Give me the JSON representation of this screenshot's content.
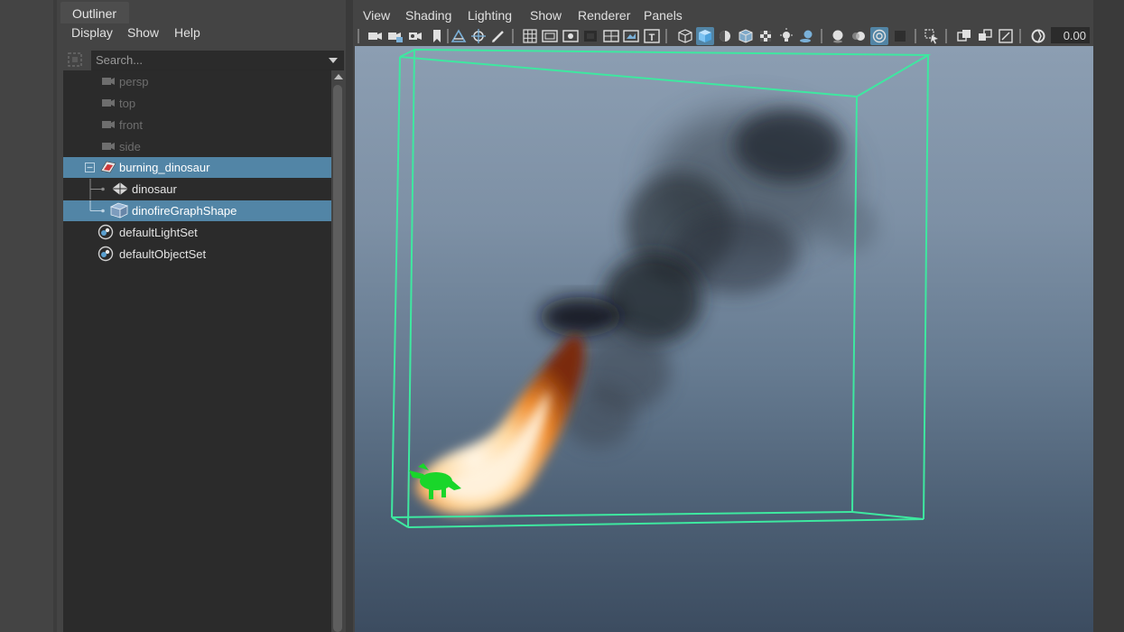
{
  "outliner": {
    "tab_title": "Outliner",
    "menu": [
      "Display",
      "Show",
      "Help"
    ],
    "search": {
      "placeholder": "Search..."
    },
    "items": [
      {
        "label": "persp",
        "icon": "camera-icon",
        "state": "dim"
      },
      {
        "label": "top",
        "icon": "camera-icon",
        "state": "dim"
      },
      {
        "label": "front",
        "icon": "camera-icon",
        "state": "dim"
      },
      {
        "label": "side",
        "icon": "camera-icon",
        "state": "dim"
      },
      {
        "label": "burning_dinosaur",
        "icon": "group-transform-icon",
        "state": "selected",
        "expand": "-"
      },
      {
        "label": "dinosaur",
        "icon": "mesh-icon",
        "state": "normal"
      },
      {
        "label": "dinofireGraphShape",
        "icon": "fluid-container-icon",
        "state": "selected"
      },
      {
        "label": "defaultLightSet",
        "icon": "set-icon",
        "state": "normal"
      },
      {
        "label": "defaultObjectSet",
        "icon": "set-icon",
        "state": "normal"
      }
    ]
  },
  "viewport": {
    "menu": [
      "View",
      "Shading",
      "Lighting",
      "Show",
      "Renderer",
      "Panels"
    ],
    "toolbar": {
      "numeric_value": "0.00",
      "icons": [
        "camera-select-icon",
        "camera-lock-icon",
        "camera-attributes-icon",
        "bookmark-icon",
        "image-plane-icon",
        "two-d-pan-icon",
        "grease-pencil-icon",
        "grid-icon",
        "film-gate-icon",
        "resolution-gate-icon",
        "gate-mask-icon",
        "field-chart-icon",
        "safe-action-icon",
        "safe-title-icon",
        "wireframe-icon",
        "smooth-shade-icon",
        "default-material-icon",
        "wireframe-on-shaded-icon",
        "textured-icon",
        "use-lights-icon",
        "shadows-icon",
        "screen-space-ao-icon",
        "motion-blur-icon",
        "multisample-aa-icon",
        "depth-of-field-icon",
        "isolate-select-icon",
        "xray-icon",
        "xray-active-icon",
        "xray-joints-icon",
        "backface-culling-icon",
        "exposure-icon"
      ]
    },
    "scene": {
      "bounding_box_color": "#3ee8a0",
      "subject": "dinosaur-model",
      "subject_color": "#19d62a",
      "effect": "fire-and-smoke-fluid"
    }
  },
  "colors": {
    "selection": "#5285a6",
    "panel": "#444444",
    "tree_bg": "#2b2b2b"
  }
}
